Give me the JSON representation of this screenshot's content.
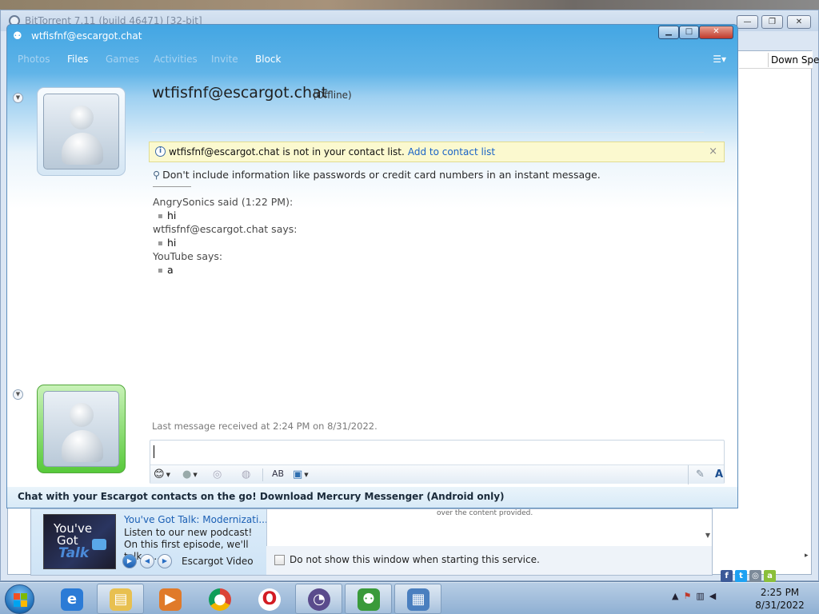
{
  "background_window": {
    "title": "BitTorrent 7.11  (build 46471) [32-bit]",
    "column_header": "Down Spe",
    "controls": {
      "minimize": "—",
      "maximize": "❐",
      "close": "✕"
    }
  },
  "chat": {
    "title": "wtfisfnf@escargot.chat",
    "window_controls": {
      "minimize": "▁",
      "maximize": "□",
      "close": "✕"
    },
    "nav": [
      "Photos",
      "Files",
      "Games",
      "Activities",
      "Invite",
      "Block"
    ],
    "contact_name": "wtfisfnf@escargot.chat",
    "contact_status": "(Offline)",
    "info_bar": {
      "message": "wtfisfnf@escargot.chat is not in your contact list.",
      "link": "Add to contact list",
      "close": "×"
    },
    "warning": "Don't include information like passwords or credit card numbers in an instant message.",
    "messages": [
      {
        "sender": "AngrySonics said (1:22 PM):",
        "text": "hi"
      },
      {
        "sender": "wtfisfnf@escargot.chat says:",
        "text": "hi"
      },
      {
        "sender": "YouTube says:",
        "text": "a"
      }
    ],
    "last_received": "Last message received at 2:24 PM on 8/31/2022.",
    "input_value": "",
    "footer": "Chat with your Escargot contacts on the go! Download Mercury Messenger (Android only)"
  },
  "promo": {
    "thumb_lines": [
      "You've",
      "Got",
      "Talk"
    ],
    "title": "You've Got Talk: Modernizati...",
    "description": "Listen to our new podcast! On this first episode, we'll talk a...",
    "source": "Escargot Video",
    "content_note": "over the content provided.",
    "checkbox_label": "Do not show this window when starting this service."
  },
  "taskbar": {
    "time": "2:25 PM",
    "date": "8/31/2022"
  },
  "colors": {
    "chat_title_blue": "#43a6e3",
    "link_blue": "#1a63c6",
    "info_bar_yellow": "#fbf9cf",
    "user_avatar_green": "#57c93a"
  }
}
